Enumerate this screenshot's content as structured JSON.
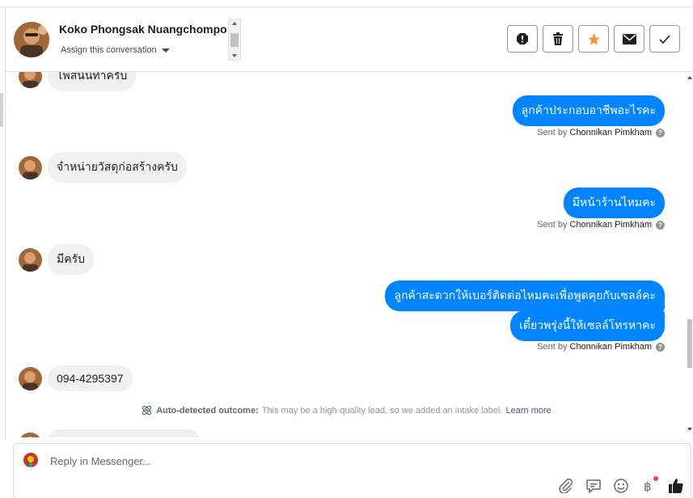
{
  "header": {
    "name": "Koko Phongsak Nuangchompoo",
    "assign_label": "Assign this conversation",
    "actions": [
      {
        "icon": "spam-alert-icon",
        "title": "Mark as spam"
      },
      {
        "icon": "trash-icon",
        "title": "Delete"
      },
      {
        "icon": "star-icon",
        "title": "Star"
      },
      {
        "icon": "envelope-icon",
        "title": "Mark as unread"
      },
      {
        "icon": "checkmark-icon",
        "title": "Mark as done"
      }
    ]
  },
  "messages": [
    {
      "dir": "in",
      "text": "โพสน์นี้ทำครับ"
    },
    {
      "dir": "out",
      "text": "ลูกค้าประกอบอาชีพอะไรคะ",
      "sent_by_label": "Sent by",
      "sent_by": "Chonnikan Pimkham"
    },
    {
      "dir": "in",
      "text": "จำหน่ายวัสดุก่อสร้างครับ"
    },
    {
      "dir": "out",
      "text": "มีหน้าร้านไหมคะ",
      "sent_by_label": "Sent by",
      "sent_by": "Chonnikan Pimkham"
    },
    {
      "dir": "in",
      "text": "มีครับ"
    },
    {
      "dir": "out",
      "text": "ลูกค้าสะดวกให้เบอร์ติดต่อไหมคะเพื่อพูดคุยกับเซลล์คะ"
    },
    {
      "dir": "out",
      "text": "เดี๋ยวพรุ่งนี้ให้เซลล์โทรหาคะ",
      "sent_by_label": "Sent by",
      "sent_by": "Chonnikan Pimkham"
    },
    {
      "dir": "in",
      "text": "094-4295397"
    }
  ],
  "auto_detected": {
    "label": "Auto-detected outcome:",
    "text": "This may be a high-quality lead, so we added an intake label.",
    "link": "Learn more"
  },
  "composer": {
    "placeholder": "Reply in Messenger...",
    "tools": [
      "paperclip-icon",
      "saved-reply-icon",
      "emoji-icon",
      "baht-payment-icon",
      "thumbs-up-icon"
    ]
  },
  "colors": {
    "accent": "#0084ff",
    "star": "#f7923b",
    "incoming_bg": "#f0f0f0"
  }
}
